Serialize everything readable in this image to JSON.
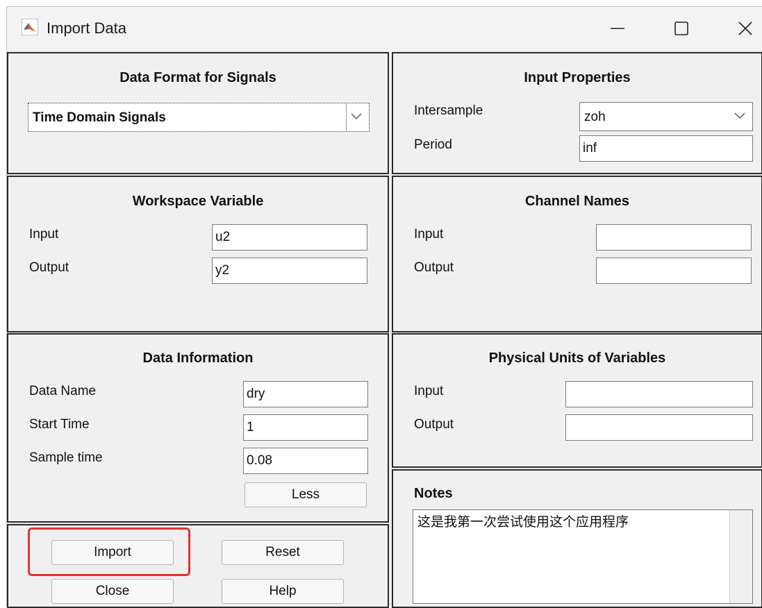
{
  "window": {
    "title": "Import Data",
    "accent": "#e8312f"
  },
  "data_format": {
    "title": "Data Format for Signals",
    "selected": "Time Domain Signals"
  },
  "input_properties": {
    "title": "Input Properties",
    "intersample_label": "Intersample",
    "intersample_value": "zoh",
    "period_label": "Period",
    "period_value": "inf"
  },
  "workspace_variable": {
    "title": "Workspace Variable",
    "input_label": "Input",
    "input_value": "u2",
    "output_label": "Output",
    "output_value": "y2"
  },
  "channel_names": {
    "title": "Channel Names",
    "input_label": "Input",
    "input_value": "",
    "output_label": "Output",
    "output_value": ""
  },
  "data_information": {
    "title": "Data Information",
    "data_name_label": "Data Name",
    "data_name_value": "dry",
    "start_time_label": "Start Time",
    "start_time_value": "1",
    "sample_time_label": "Sample time",
    "sample_time_value": "0.08",
    "less_button": "Less"
  },
  "physical_units": {
    "title": "Physical Units of Variables",
    "input_label": "Input",
    "input_value": "",
    "output_label": "Output",
    "output_value": ""
  },
  "notes": {
    "title": "Notes",
    "text": "这是我第一次尝试使用这个应用程序"
  },
  "actions": {
    "import": "Import",
    "reset": "Reset",
    "close": "Close",
    "help": "Help"
  }
}
